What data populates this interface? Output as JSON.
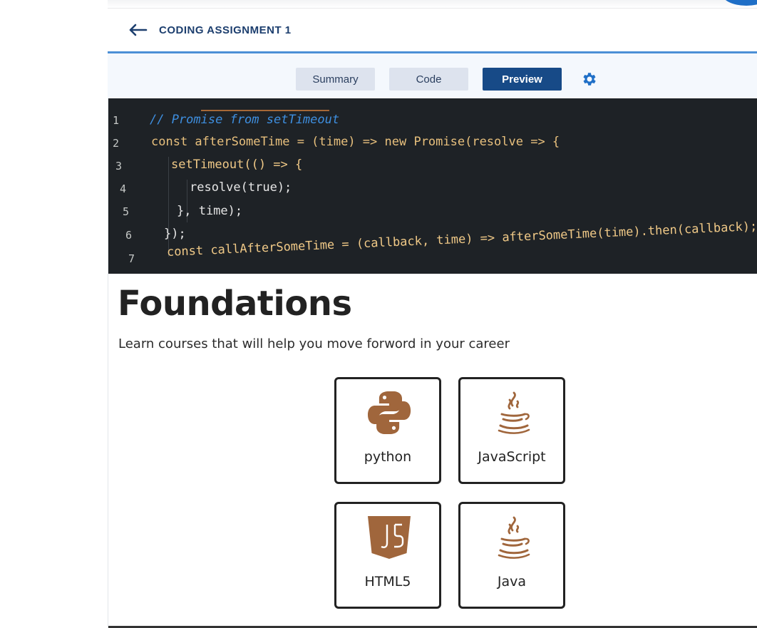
{
  "header": {
    "title": "CODING ASSIGNMENT 1"
  },
  "tabs": [
    {
      "label": "Summary",
      "active": false
    },
    {
      "label": "Code",
      "active": false
    },
    {
      "label": "Preview",
      "active": true
    }
  ],
  "hero_code": {
    "line_numbers": [
      "1",
      "2",
      "3",
      "4",
      "5",
      "6",
      "7"
    ],
    "lines": [
      "// Promise from setTimeout",
      "const afterSomeTime = (time) => new Promise(resolve => {",
      "setTimeout(() => {",
      "resolve(true);",
      "}, time);",
      "});",
      "const callAfterSomeTime = (callback, time) => afterSomeTime(time).then(callback);"
    ]
  },
  "content": {
    "heading": "Foundations",
    "subheading": "Learn courses that will help you move forword in your career",
    "cards": [
      {
        "label": "python",
        "icon": "python-icon"
      },
      {
        "label": "JavaScript",
        "icon": "java-cup-icon"
      },
      {
        "label": "HTML5",
        "icon": "js-shield-icon"
      },
      {
        "label": "Java",
        "icon": "java-cup-icon"
      }
    ]
  },
  "colors": {
    "title": "#1c3e6e",
    "accent_line": "#4b8fd6",
    "tab_active": "#174a87",
    "tab_inactive": "#dde3ee",
    "gear": "#1f6fc7",
    "icon_brown": "#a0663c"
  }
}
